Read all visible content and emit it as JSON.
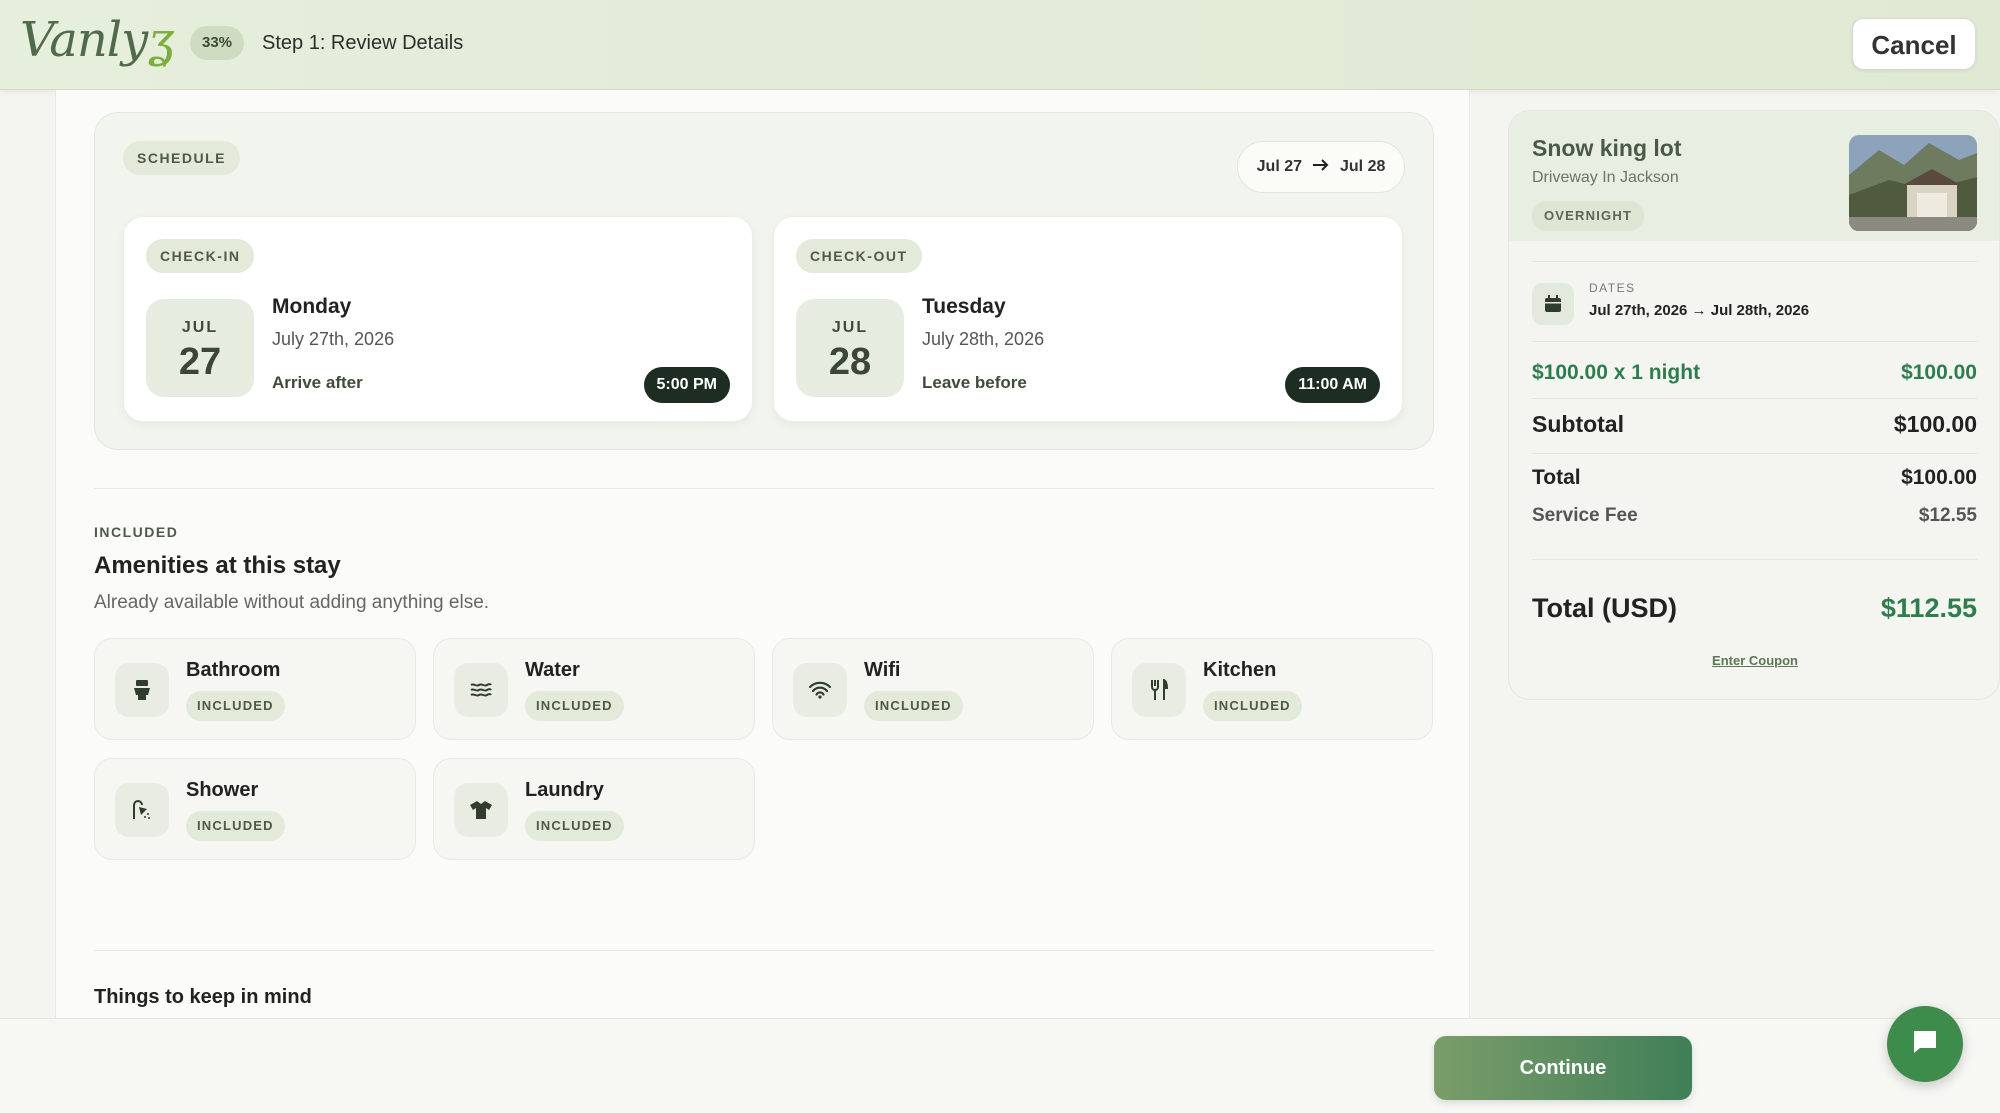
{
  "header": {
    "logo_text": "Vanly",
    "progress": "33%",
    "step_title": "Step 1: Review Details",
    "cancel_label": "Cancel"
  },
  "schedule": {
    "label": "SCHEDULE",
    "range_start": "Jul 27",
    "range_arrow": "→",
    "range_end": "Jul 28",
    "check_in": {
      "label": "CHECK-IN",
      "month": "JUL",
      "day": "27",
      "weekday": "Monday",
      "date_full": "July 27th, 2026",
      "note": "Arrive after",
      "time": "5:00 PM"
    },
    "check_out": {
      "label": "CHECK-OUT",
      "month": "JUL",
      "day": "28",
      "weekday": "Tuesday",
      "date_full": "July 28th, 2026",
      "note": "Leave before",
      "time": "11:00 AM"
    }
  },
  "amenities": {
    "eyebrow": "INCLUDED",
    "title": "Amenities at this stay",
    "subtitle": "Already available without adding anything else.",
    "items": [
      {
        "name": "Bathroom",
        "badge": "INCLUDED",
        "icon": "toilet-icon"
      },
      {
        "name": "Water",
        "badge": "INCLUDED",
        "icon": "water-icon"
      },
      {
        "name": "Wifi",
        "badge": "INCLUDED",
        "icon": "wifi-icon"
      },
      {
        "name": "Kitchen",
        "badge": "INCLUDED",
        "icon": "utensils-icon"
      },
      {
        "name": "Shower",
        "badge": "INCLUDED",
        "icon": "shower-icon"
      },
      {
        "name": "Laundry",
        "badge": "INCLUDED",
        "icon": "shirt-icon"
      }
    ]
  },
  "keep_in_mind": {
    "title": "Things to keep in mind"
  },
  "summary": {
    "property_name": "Snow king lot",
    "property_type": "Driveway In Jackson",
    "badge": "OVERNIGHT",
    "dates_label": "DATES",
    "dates_value": "Jul 27th, 2026 → Jul 28th, 2026",
    "line_item_label": "$100.00 x 1 night",
    "line_item_value": "$100.00",
    "subtotal_label": "Subtotal",
    "subtotal_value": "$100.00",
    "total_label": "Total",
    "total_value": "$100.00",
    "fee_label": "Service Fee",
    "fee_value": "$12.55",
    "grand_label": "Total (USD)",
    "grand_value": "$112.55",
    "coupon_label": "Enter Coupon"
  },
  "footer": {
    "continue_label": "Continue"
  },
  "colors": {
    "accent_green": "#3f7f57",
    "price_green": "#2e7d4f",
    "dark_badge": "#1d2d21",
    "chat_button": "#3e8c4c"
  }
}
